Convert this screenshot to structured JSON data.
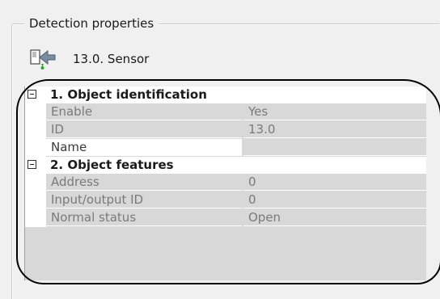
{
  "group": {
    "title": "Detection properties"
  },
  "header": {
    "label": "13.0. Sensor",
    "icon": "sensor-arrow-icon"
  },
  "categories": [
    {
      "label": "1. Object identification",
      "rows": [
        {
          "name": "Enable",
          "value": "Yes"
        },
        {
          "name": "ID",
          "value": "13.0"
        },
        {
          "name": "Name",
          "value": ""
        }
      ]
    },
    {
      "label": "2. Object features",
      "rows": [
        {
          "name": "Address",
          "value": "0"
        },
        {
          "name": "Input/output ID",
          "value": "0"
        },
        {
          "name": "Normal status",
          "value": "Open"
        }
      ]
    }
  ],
  "colors": {
    "row_background": "#d8d8d8",
    "category_background": "#ffffff",
    "annotation_outline": "#000000"
  }
}
